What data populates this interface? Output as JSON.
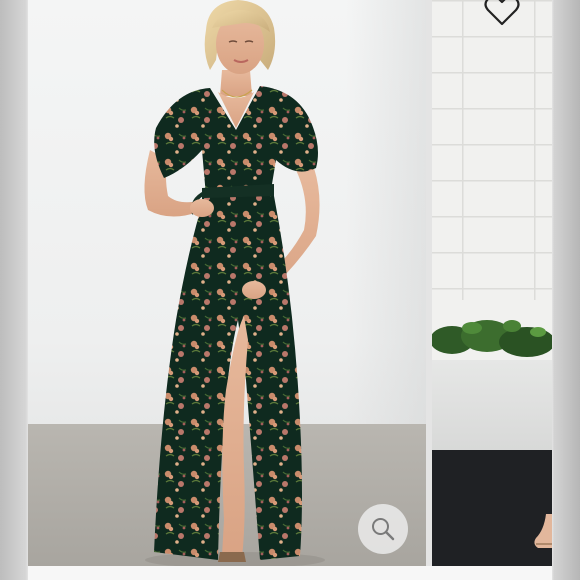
{
  "gallery": {
    "current_image": {
      "subject": "",
      "alt": ""
    },
    "next_image": {
      "alt": ""
    },
    "icons": {
      "zoom": "search-icon",
      "favorite": "heart-icon"
    },
    "colors": {
      "dress_base": "#0f2a1f",
      "floral_accent": "#c98b6b",
      "backdrop": "#f0f1f1",
      "floor": "#b0ada7"
    }
  }
}
